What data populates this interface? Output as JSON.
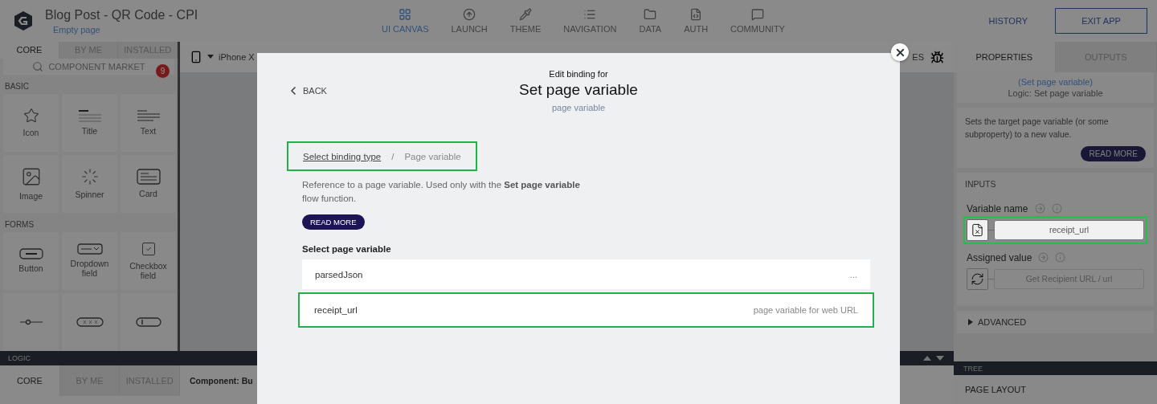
{
  "app_header": {
    "title": "Blog Post - QR Code - CPI",
    "page": "Empty page",
    "nav": [
      {
        "label": "UI CANVAS",
        "kind": "canvas",
        "selected": true
      },
      {
        "label": "LAUNCH",
        "kind": "launch",
        "selected": false
      },
      {
        "label": "THEME",
        "kind": "theme",
        "selected": false
      },
      {
        "label": "NAVIGATION",
        "kind": "navigation",
        "selected": false
      },
      {
        "label": "DATA",
        "kind": "data",
        "selected": false
      },
      {
        "label": "AUTH",
        "kind": "auth",
        "selected": false
      },
      {
        "label": "COMMUNITY",
        "kind": "community",
        "selected": false
      }
    ],
    "history": "HISTORY",
    "exit": "EXIT APP"
  },
  "left_panel": {
    "tabs": [
      {
        "label": "CORE",
        "selected": true
      },
      {
        "label": "BY ME",
        "selected": false
      },
      {
        "label": "INSTALLED",
        "selected": false
      }
    ],
    "market": {
      "label": "COMPONENT MARKET",
      "badge": "9"
    },
    "sections": [
      {
        "title": "BASIC",
        "items": [
          {
            "label": "Icon",
            "kind": "icon"
          },
          {
            "label": "Title",
            "kind": "title"
          },
          {
            "label": "Text",
            "kind": "text"
          },
          {
            "label": "Image",
            "kind": "image"
          },
          {
            "label": "Spinner",
            "kind": "spinner"
          },
          {
            "label": "Card",
            "kind": "card"
          }
        ]
      },
      {
        "title": "FORMS",
        "items": [
          {
            "label": "Button",
            "kind": "button"
          },
          {
            "label": "Dropdown field",
            "kind": "dropdown"
          },
          {
            "label": "Checkbox field",
            "kind": "checkbox"
          },
          {
            "kind": "slider"
          },
          {
            "kind": "password"
          },
          {
            "kind": "toggle"
          }
        ]
      }
    ]
  },
  "canvas_toolbar": {
    "device": "iPhone X",
    "views_label": "ES"
  },
  "logic_panel": {
    "title": "LOGIC",
    "tabs": [
      {
        "label": "CORE",
        "selected": true
      },
      {
        "label": "BY ME",
        "selected": false
      },
      {
        "label": "INSTALLED",
        "selected": false
      }
    ],
    "component_label": "Component: Bu"
  },
  "right_panel": {
    "tabs": [
      {
        "label": "PROPERTIES",
        "selected": true
      },
      {
        "label": "OUTPUTS",
        "selected": false
      }
    ],
    "node_link": "(Set page variable)",
    "node_title": "Logic: Set page variable",
    "description": "Sets the target page variable (or some subproperty) to a new value.",
    "read_more": "READ MORE",
    "inputs_title": "INPUTS",
    "inputs": [
      {
        "label": "Variable name",
        "kind": "variable",
        "value": "receipt_url",
        "highlighted": true
      },
      {
        "label": "Assigned value",
        "kind": "expression",
        "value": "Get Recipient URL / url",
        "highlighted": false
      }
    ],
    "advanced": {
      "label": "ADVANCED",
      "expanded": false
    }
  },
  "tree_panel": {
    "title": "TREE",
    "section": "PAGE LAYOUT"
  },
  "modal": {
    "eyebrow": "Edit binding for",
    "title": "Set page variable",
    "subtitle": "page variable",
    "back": "BACK",
    "breadcrumb": {
      "highlighted": true,
      "items": [
        {
          "label": "Select binding type",
          "kind": "link"
        },
        {
          "label": "/",
          "kind": "separator"
        },
        {
          "label": "Page variable",
          "kind": "current"
        }
      ]
    },
    "description": "Reference to a page variable. Used only with the **Set page variable** flow function.",
    "read_more": "READ MORE",
    "list_label": "Select page variable",
    "variables": [
      {
        "name": "parsedJson",
        "note": "...",
        "highlighted": false
      },
      {
        "name": "receipt_url",
        "note": "page variable for web URL",
        "highlighted": true
      }
    ]
  }
}
